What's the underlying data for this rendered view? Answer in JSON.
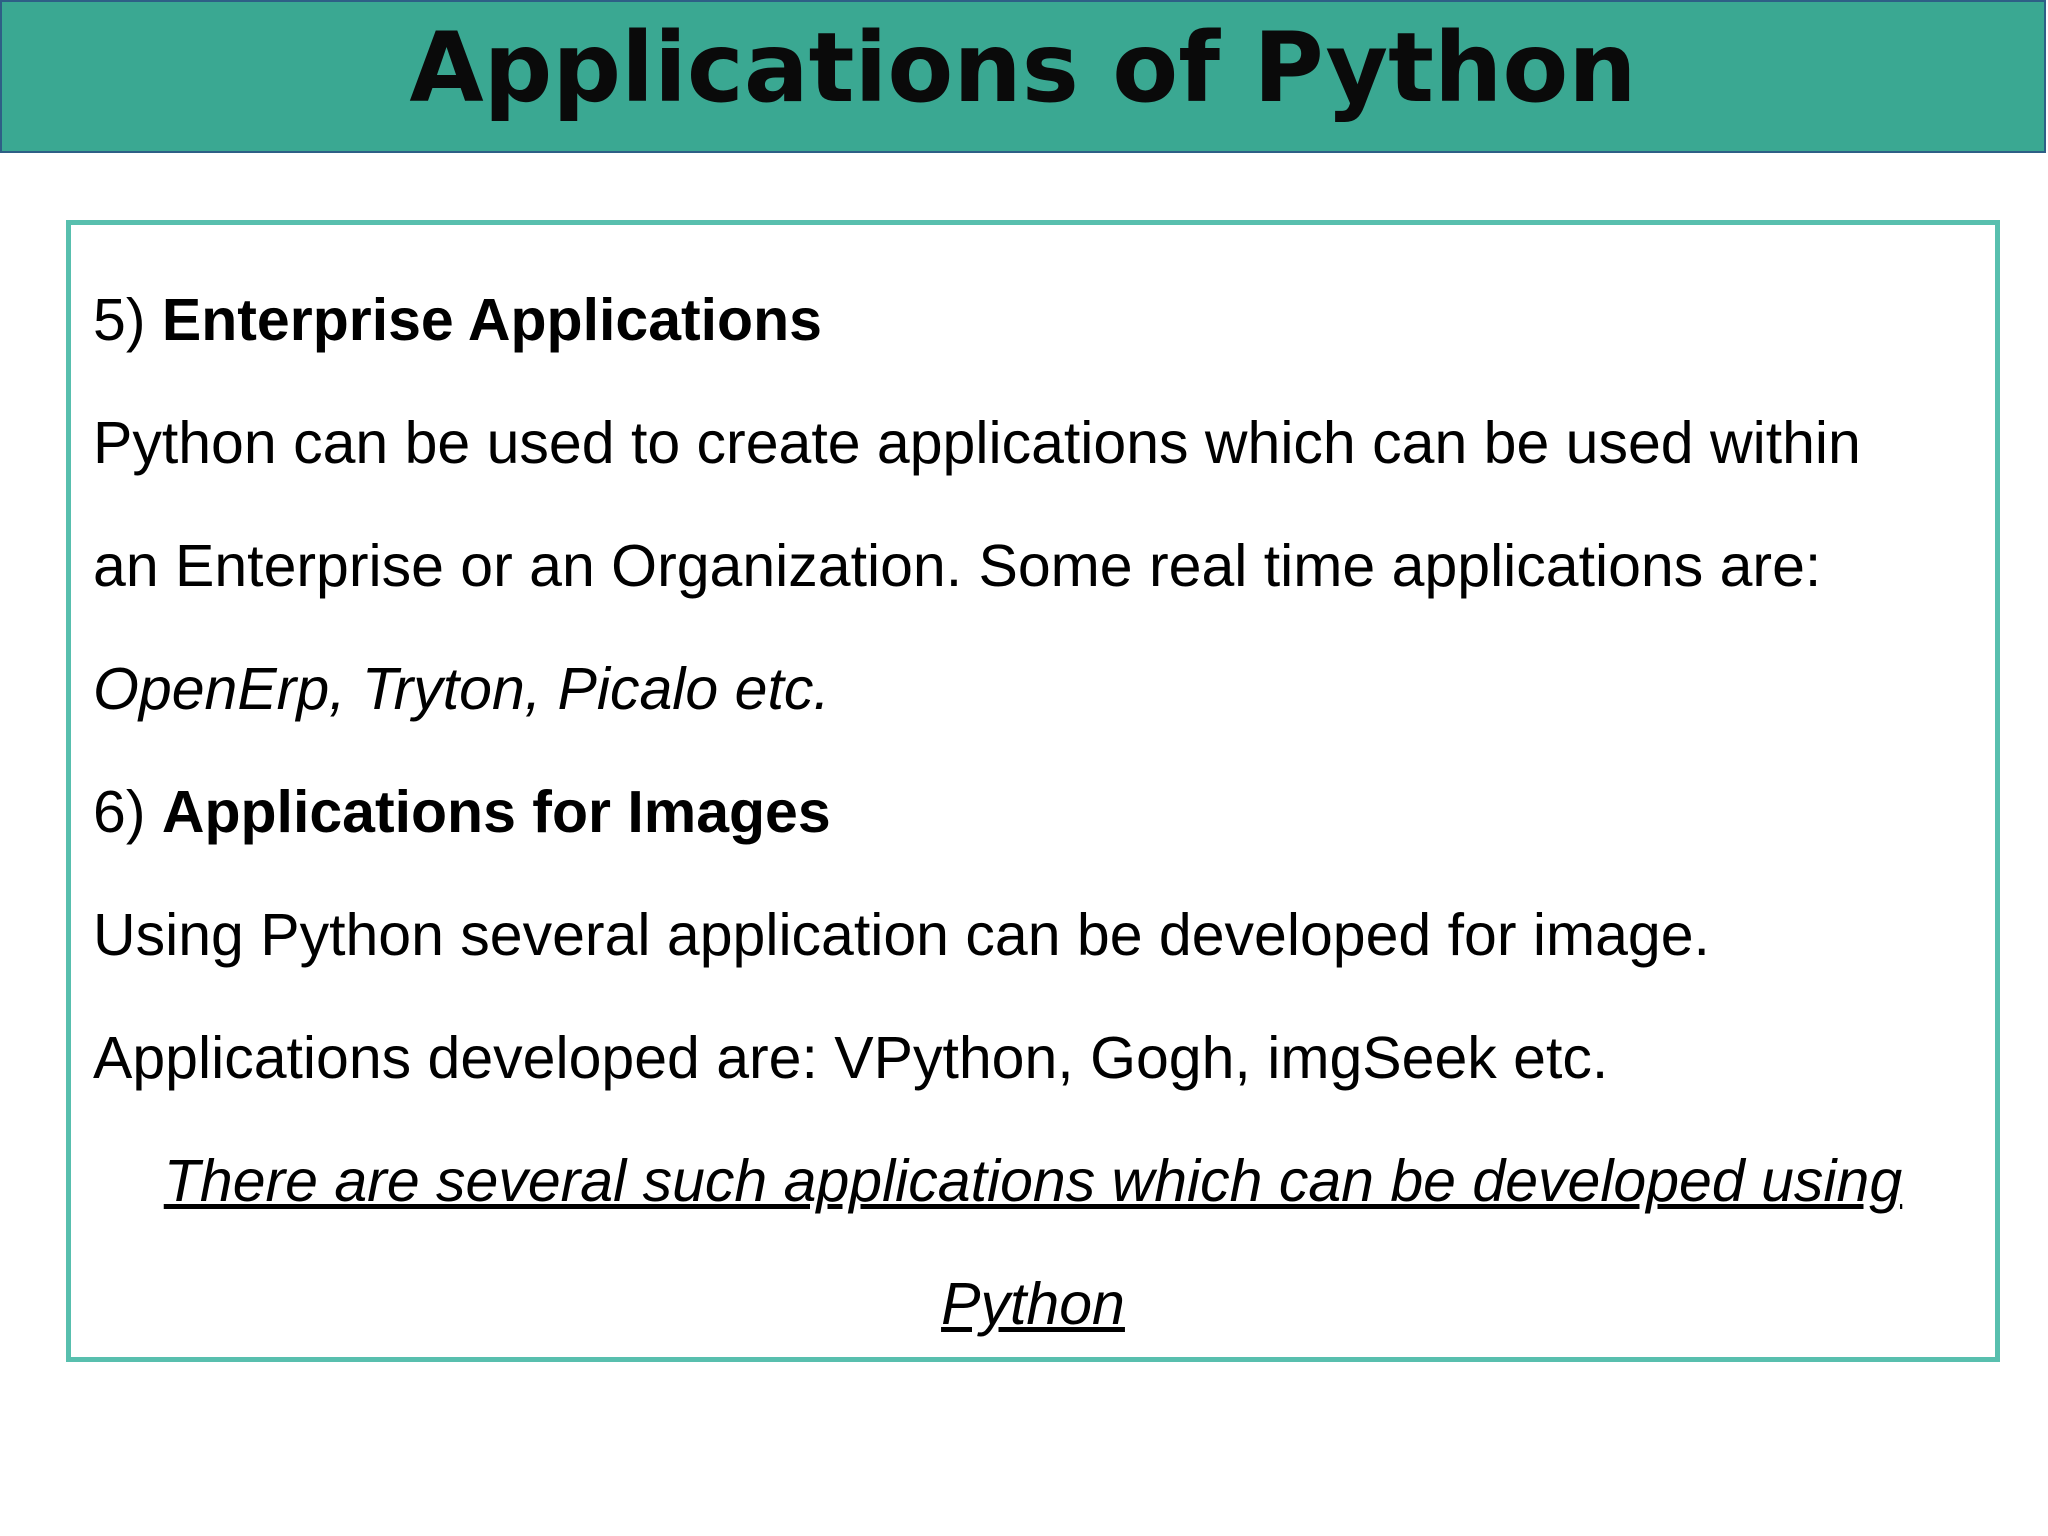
{
  "slide": {
    "title": "Applications of Python"
  },
  "content": {
    "section5": {
      "number": "5)",
      "heading": "Enterprise Applications",
      "body_line1": "Python can be used to create applications which can be used within",
      "body_line2": "an Enterprise or an Organization. Some real time applications are:",
      "examples": "OpenErp, Tryton, Picalo etc."
    },
    "section6": {
      "number": "6)",
      "heading": "Applications for Images",
      "body_line1": "Using Python several application can be developed for image.",
      "body_line2": "Applications developed are: VPython, Gogh, imgSeek etc."
    },
    "closing": {
      "line1": "There are several such applications which can be developed using",
      "line2": "Python"
    }
  },
  "colors": {
    "title_bg": "#3aa892",
    "title_border": "#2e5f86",
    "box_border": "#58bfae"
  }
}
